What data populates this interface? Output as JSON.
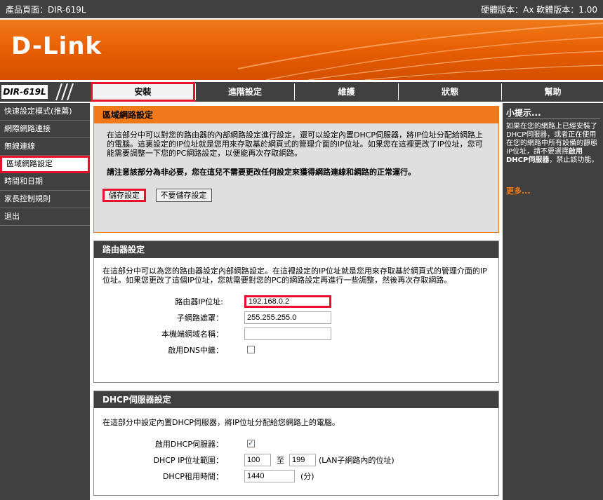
{
  "topbar": {
    "product_page": "產品頁面：DIR-619L",
    "versions": "硬體版本：Ax  軟體版本：1.00"
  },
  "banner": {
    "logo": "D-Link"
  },
  "nav": {
    "model": "DIR-619L",
    "tabs": [
      {
        "label": "安裝"
      },
      {
        "label": "進階設定"
      },
      {
        "label": "維護"
      },
      {
        "label": "狀態"
      },
      {
        "label": "幫助"
      }
    ]
  },
  "sidebar": {
    "items": [
      {
        "label": "快速設定模式(推薦)"
      },
      {
        "label": "網際網路連接"
      },
      {
        "label": "無線連線"
      },
      {
        "label": "區域網路設定"
      },
      {
        "label": "時間和日期"
      },
      {
        "label": "家長控制規則"
      },
      {
        "label": "退出"
      }
    ]
  },
  "lan": {
    "title": "區域網路設定",
    "desc": "在這部分中可以對您的路由器的內部網路設定進行設定，還可以設定內置DHCP伺服器，將IP位址分配給網路上的電腦。這裏設定的IP位址就是您用來存取基於網頁式的管理介面的IP位址。如果您在這裡更改了IP位址，您可能需要調整一下您的PC網路設定，以便能再次存取網路。",
    "notice": "請注意該部分為非必要，您在這兒不需要更改任何設定來獲得網路連線和網路的正常運行。",
    "save_button": "儲存設定",
    "nosave_button": "不要儲存設定"
  },
  "router": {
    "title": "路由器設定",
    "desc": "在這部分中可以為您的路由器設定內部網路設定。在這裡設定的IP位址就是您用來存取基於網頁式的管理介面的IP位址。如果您更改了這個IP位址，您就需要對您的PC的網路設定再進行一些調整，然後再次存取網路。",
    "ip_label": "路由器IP位址:",
    "ip_value": "192.168.0.2",
    "mask_label": "子網路遮罩：",
    "mask_value": "255.255.255.0",
    "domain_label": "本機端網域名稱：",
    "domain_value": "",
    "dns_label": "啟用DNS中繼："
  },
  "dhcp": {
    "title": "DHCP伺服器設定",
    "desc": "在這部分中設定內置DHCP伺服器，將IP位址分配給您網路上的電腦。",
    "enable_label": "啟用DHCP伺服器：",
    "range_label": "DHCP IP位址範圍：",
    "range_start": "100",
    "range_to": "至",
    "range_end": "199",
    "range_note": "(LAN子網路內的位址)",
    "lease_label": "DHCP租用時間：",
    "lease_value": "1440",
    "lease_unit": "(分)"
  },
  "tips": {
    "title": "小提示...",
    "body_pre": "如果在您的網路上已經安裝了DHCP伺服器，或者正在使用在您的網路中所有設備的靜態IP位址，請不要選擇",
    "body_bold": "啟用DHCP伺服器",
    "body_post": "，禁止該功能。",
    "more": "更多..."
  },
  "colors": {
    "accent": "#f07a1a",
    "highlight": "#e8112d",
    "dark": "#404040"
  }
}
